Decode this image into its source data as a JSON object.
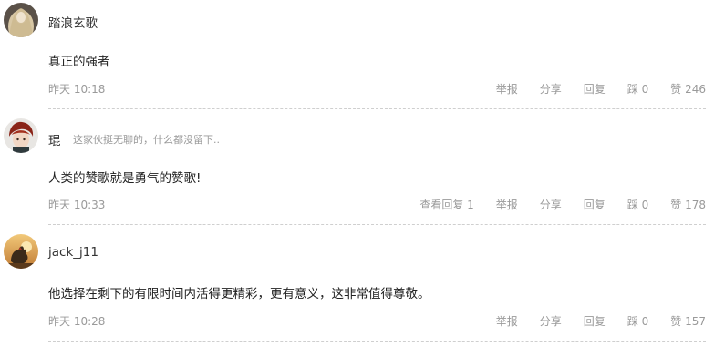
{
  "comments": [
    {
      "username": "踏浪玄歌",
      "bio": "",
      "content": "真正的强者",
      "time": "昨天 10:18",
      "view_replies": "",
      "report": "举报",
      "share": "分享",
      "reply": "回复",
      "dislike": "踩 0",
      "like": "赞 246"
    },
    {
      "username": "琨",
      "bio": "这家伙挺无聊的，什么都没留下..",
      "content": "人类的赞歌就是勇气的赞歌!",
      "time": "昨天 10:33",
      "view_replies": "查看回复 1",
      "report": "举报",
      "share": "分享",
      "reply": "回复",
      "dislike": "踩 0",
      "like": "赞 178"
    },
    {
      "username": "jack_j11",
      "bio": "",
      "content": "他选择在剩下的有限时间内活得更精彩，更有意义，这非常值得尊敬。",
      "time": "昨天 10:28",
      "view_replies": "",
      "report": "举报",
      "share": "分享",
      "reply": "回复",
      "dislike": "踩 0",
      "like": "赞 157"
    }
  ],
  "icons": {
    "avatar_1": "avatar-blonde-hair",
    "avatar_2": "avatar-anime-red-hair",
    "avatar_3": "avatar-rooster-sunset"
  }
}
